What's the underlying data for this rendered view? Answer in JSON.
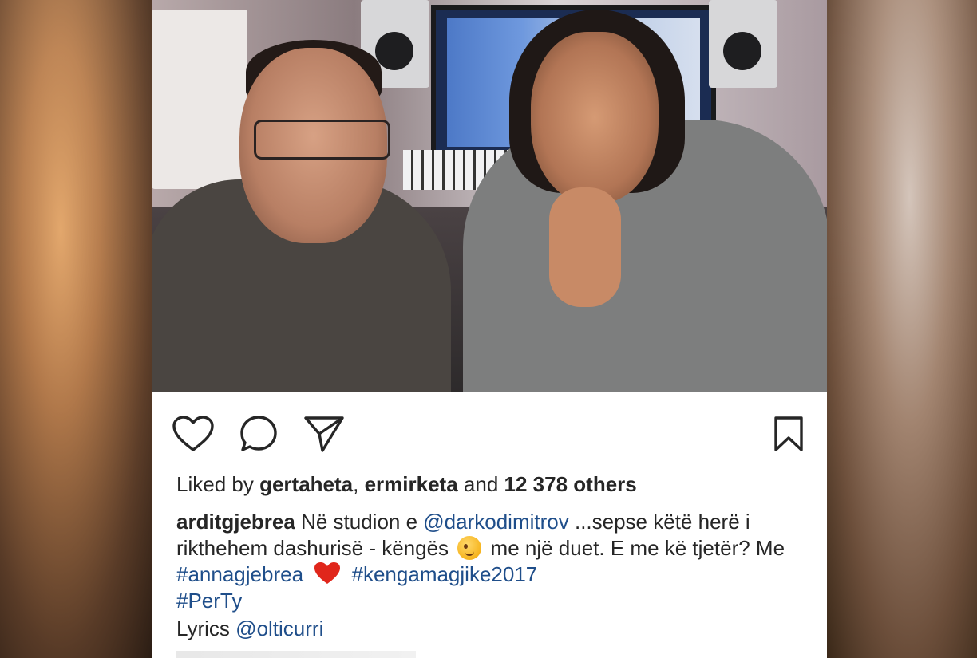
{
  "post": {
    "likes": {
      "prefix": "Liked by",
      "user1": "gertaheta",
      "separator": ",",
      "user2": "ermirketa",
      "and": "and",
      "count": "12 378 others"
    },
    "caption": {
      "username": "arditgjebrea",
      "text1": "Në studion e",
      "mention1": "@darkodimitrov",
      "text2": "...sepse këtë herë i rikthehem dashurisë - këngës",
      "text3": "me një duet. E me kë tjetër?  Me",
      "hashtag1": "#annagjebrea",
      "hashtag2": "#kengamagjike2017",
      "hashtag3": "#PerTy"
    },
    "lyrics": {
      "label": "Lyrics",
      "mention": "@olticurri"
    }
  },
  "icons": {
    "like": "heart-outline-icon",
    "comment": "comment-bubble-icon",
    "share": "paper-plane-icon",
    "save": "bookmark-icon",
    "wink": "winking-face-emoji",
    "heart": "red-heart-emoji"
  },
  "colors": {
    "text": "#262626",
    "link": "#1f4e8a",
    "heart": "#e0261b"
  }
}
